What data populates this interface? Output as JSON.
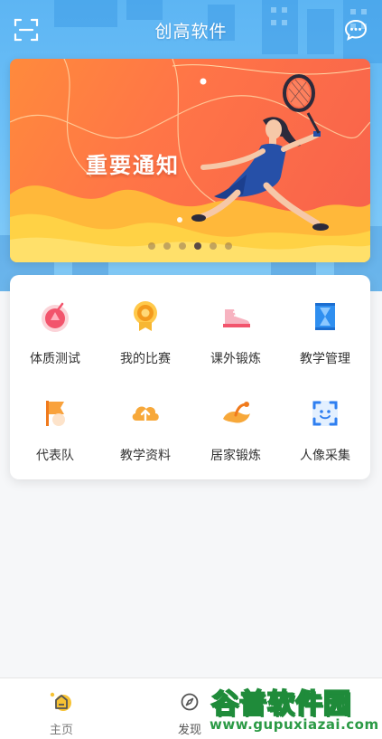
{
  "app": {
    "title": "创高软件"
  },
  "banner": {
    "text": "重要通知",
    "dot_count": 6,
    "active_dot": 3
  },
  "grid": {
    "items": [
      {
        "label": "体质测试",
        "icon": "body-test-icon"
      },
      {
        "label": "我的比赛",
        "icon": "medal-icon"
      },
      {
        "label": "课外锻炼",
        "icon": "running-shoe-icon"
      },
      {
        "label": "教学管理",
        "icon": "hourglass-icon"
      },
      {
        "label": "代表队",
        "icon": "flag-icon"
      },
      {
        "label": "教学资料",
        "icon": "cloud-upload-icon"
      },
      {
        "label": "居家锻炼",
        "icon": "home-exercise-icon"
      },
      {
        "label": "人像采集",
        "icon": "face-scan-icon"
      }
    ]
  },
  "nav": {
    "home": "主页",
    "discover": "发现"
  },
  "watermark": {
    "title": "谷普软件园",
    "url": "www.gupuxiazai.com"
  },
  "colors": {
    "header_blue": "#5db5f3",
    "banner_orange": "#ff7547",
    "accent_yellow": "#f7c233",
    "watermark_green": "#1f8b3a"
  }
}
